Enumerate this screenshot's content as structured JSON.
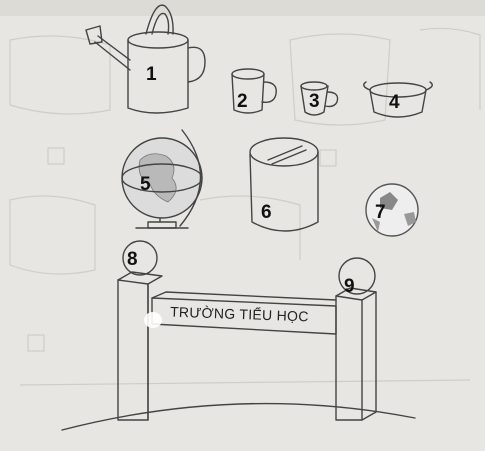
{
  "objects": [
    {
      "number": "1",
      "name": "watering can"
    },
    {
      "number": "2",
      "name": "mug"
    },
    {
      "number": "3",
      "name": "cup"
    },
    {
      "number": "4",
      "name": "pot"
    },
    {
      "number": "5",
      "name": "globe"
    },
    {
      "number": "6",
      "name": "box"
    },
    {
      "number": "7",
      "name": "ball"
    },
    {
      "number": "8",
      "name": "left gate pillar"
    },
    {
      "number": "9",
      "name": "right gate pillar"
    }
  ],
  "sign": {
    "text": "TRƯỜNG TIỂU HỌC"
  },
  "colors": {
    "paper": "#e7e6e2",
    "ink": "#444444",
    "label": "#111111"
  }
}
